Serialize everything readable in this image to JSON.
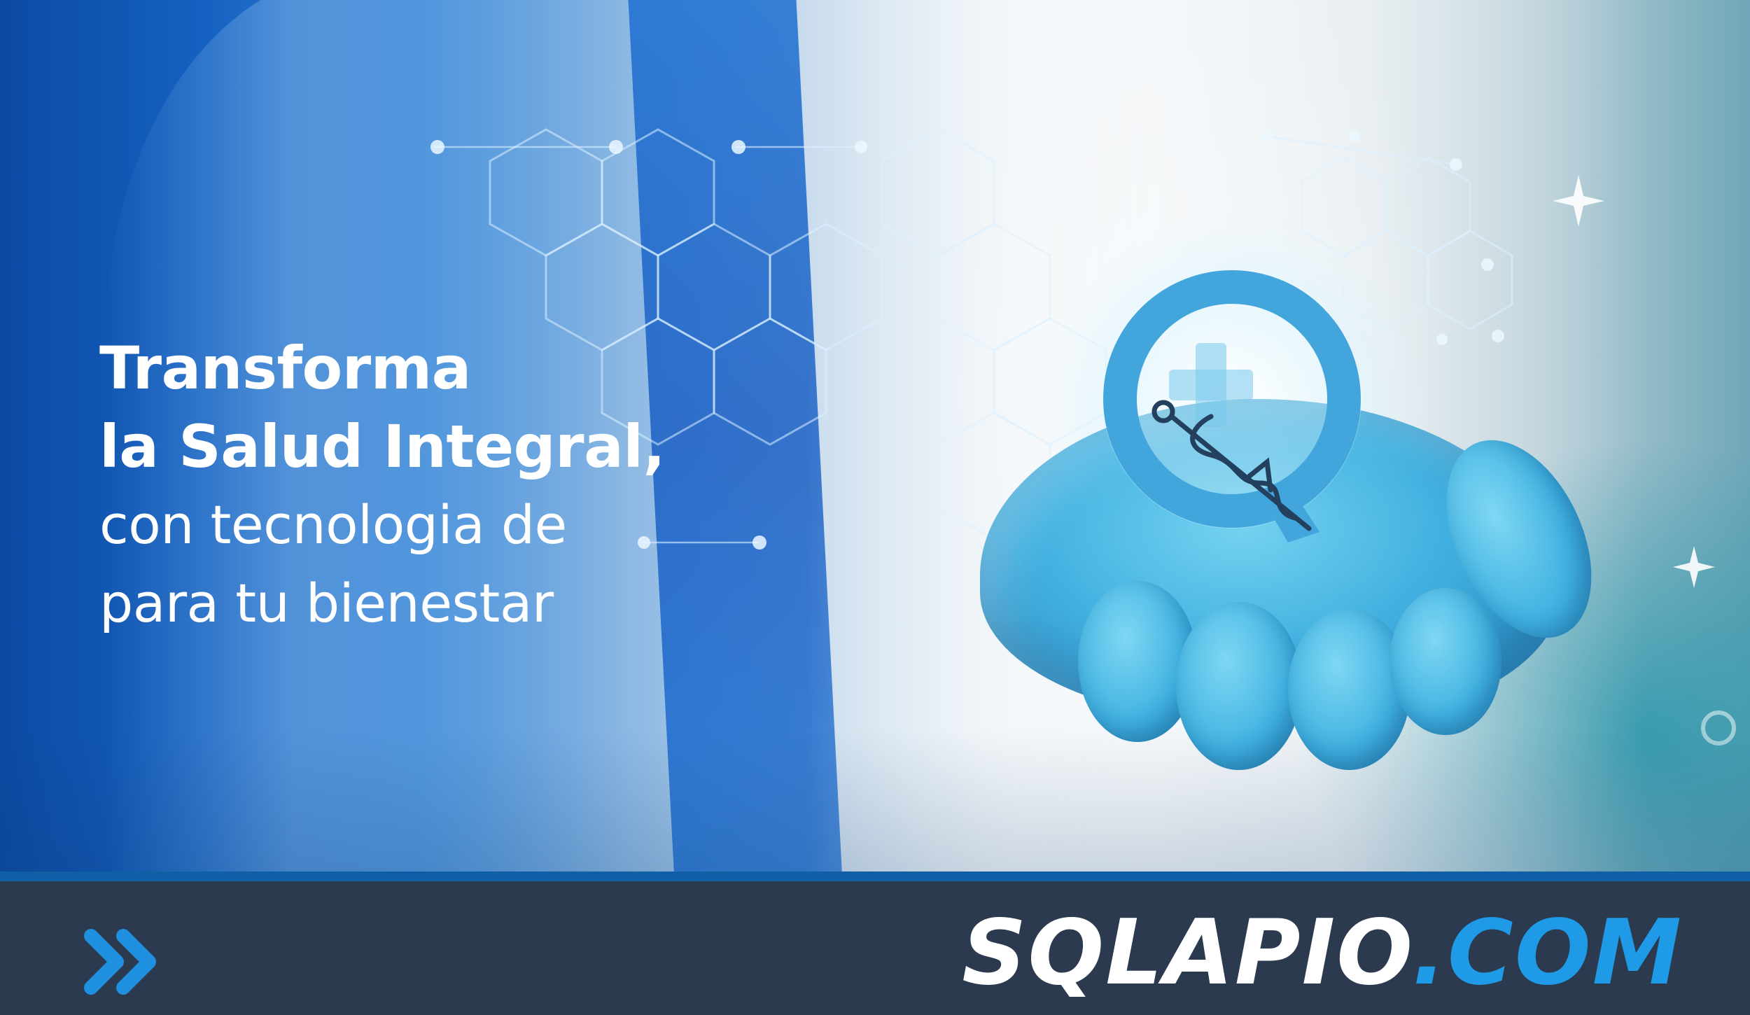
{
  "headline": {
    "line1": "Transforma",
    "line2": "la Salud Integral,",
    "line3": "con tecnologia de",
    "line4": "para tu bienestar"
  },
  "footer": {
    "brand_main": "SQLAPIO",
    "brand_tld": ".COM",
    "chevron_icon": "double-chevron-right-icon"
  },
  "colors": {
    "footer_bg": "#2b3a4e",
    "footer_stripe": "#0e5fa6",
    "accent_blue": "#1f9ae6",
    "glove_blue": "#39aee0",
    "headline_text": "#ffffff"
  },
  "icons": [
    "medical-cross-icon",
    "caduceus-icon",
    "magnifier-ring-icon",
    "double-chevron-right-icon"
  ]
}
